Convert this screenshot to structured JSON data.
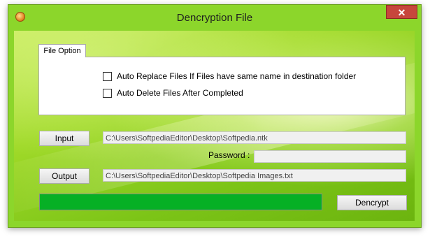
{
  "window": {
    "title": "Dencryption File",
    "close_glyph": "✕"
  },
  "tab": {
    "label": "File Option"
  },
  "options": [
    {
      "label": "Auto Replace Files If Files have same name in destination folder",
      "checked": false
    },
    {
      "label": "Auto Delete Files After Completed",
      "checked": false
    }
  ],
  "input": {
    "button": "Input",
    "path": "C:\\Users\\SoftpediaEditor\\Desktop\\Softpedia.ntk"
  },
  "password": {
    "label": "Password :",
    "value": ""
  },
  "output": {
    "button": "Output",
    "path": "C:\\Users\\SoftpediaEditor\\Desktop\\Softpedia Images.txt"
  },
  "progress": {
    "fraction": 1.0,
    "color": "#06b025"
  },
  "action": {
    "button": "Dencrypt"
  },
  "colors": {
    "accent": "#8cd62b",
    "close": "#c7463c"
  }
}
